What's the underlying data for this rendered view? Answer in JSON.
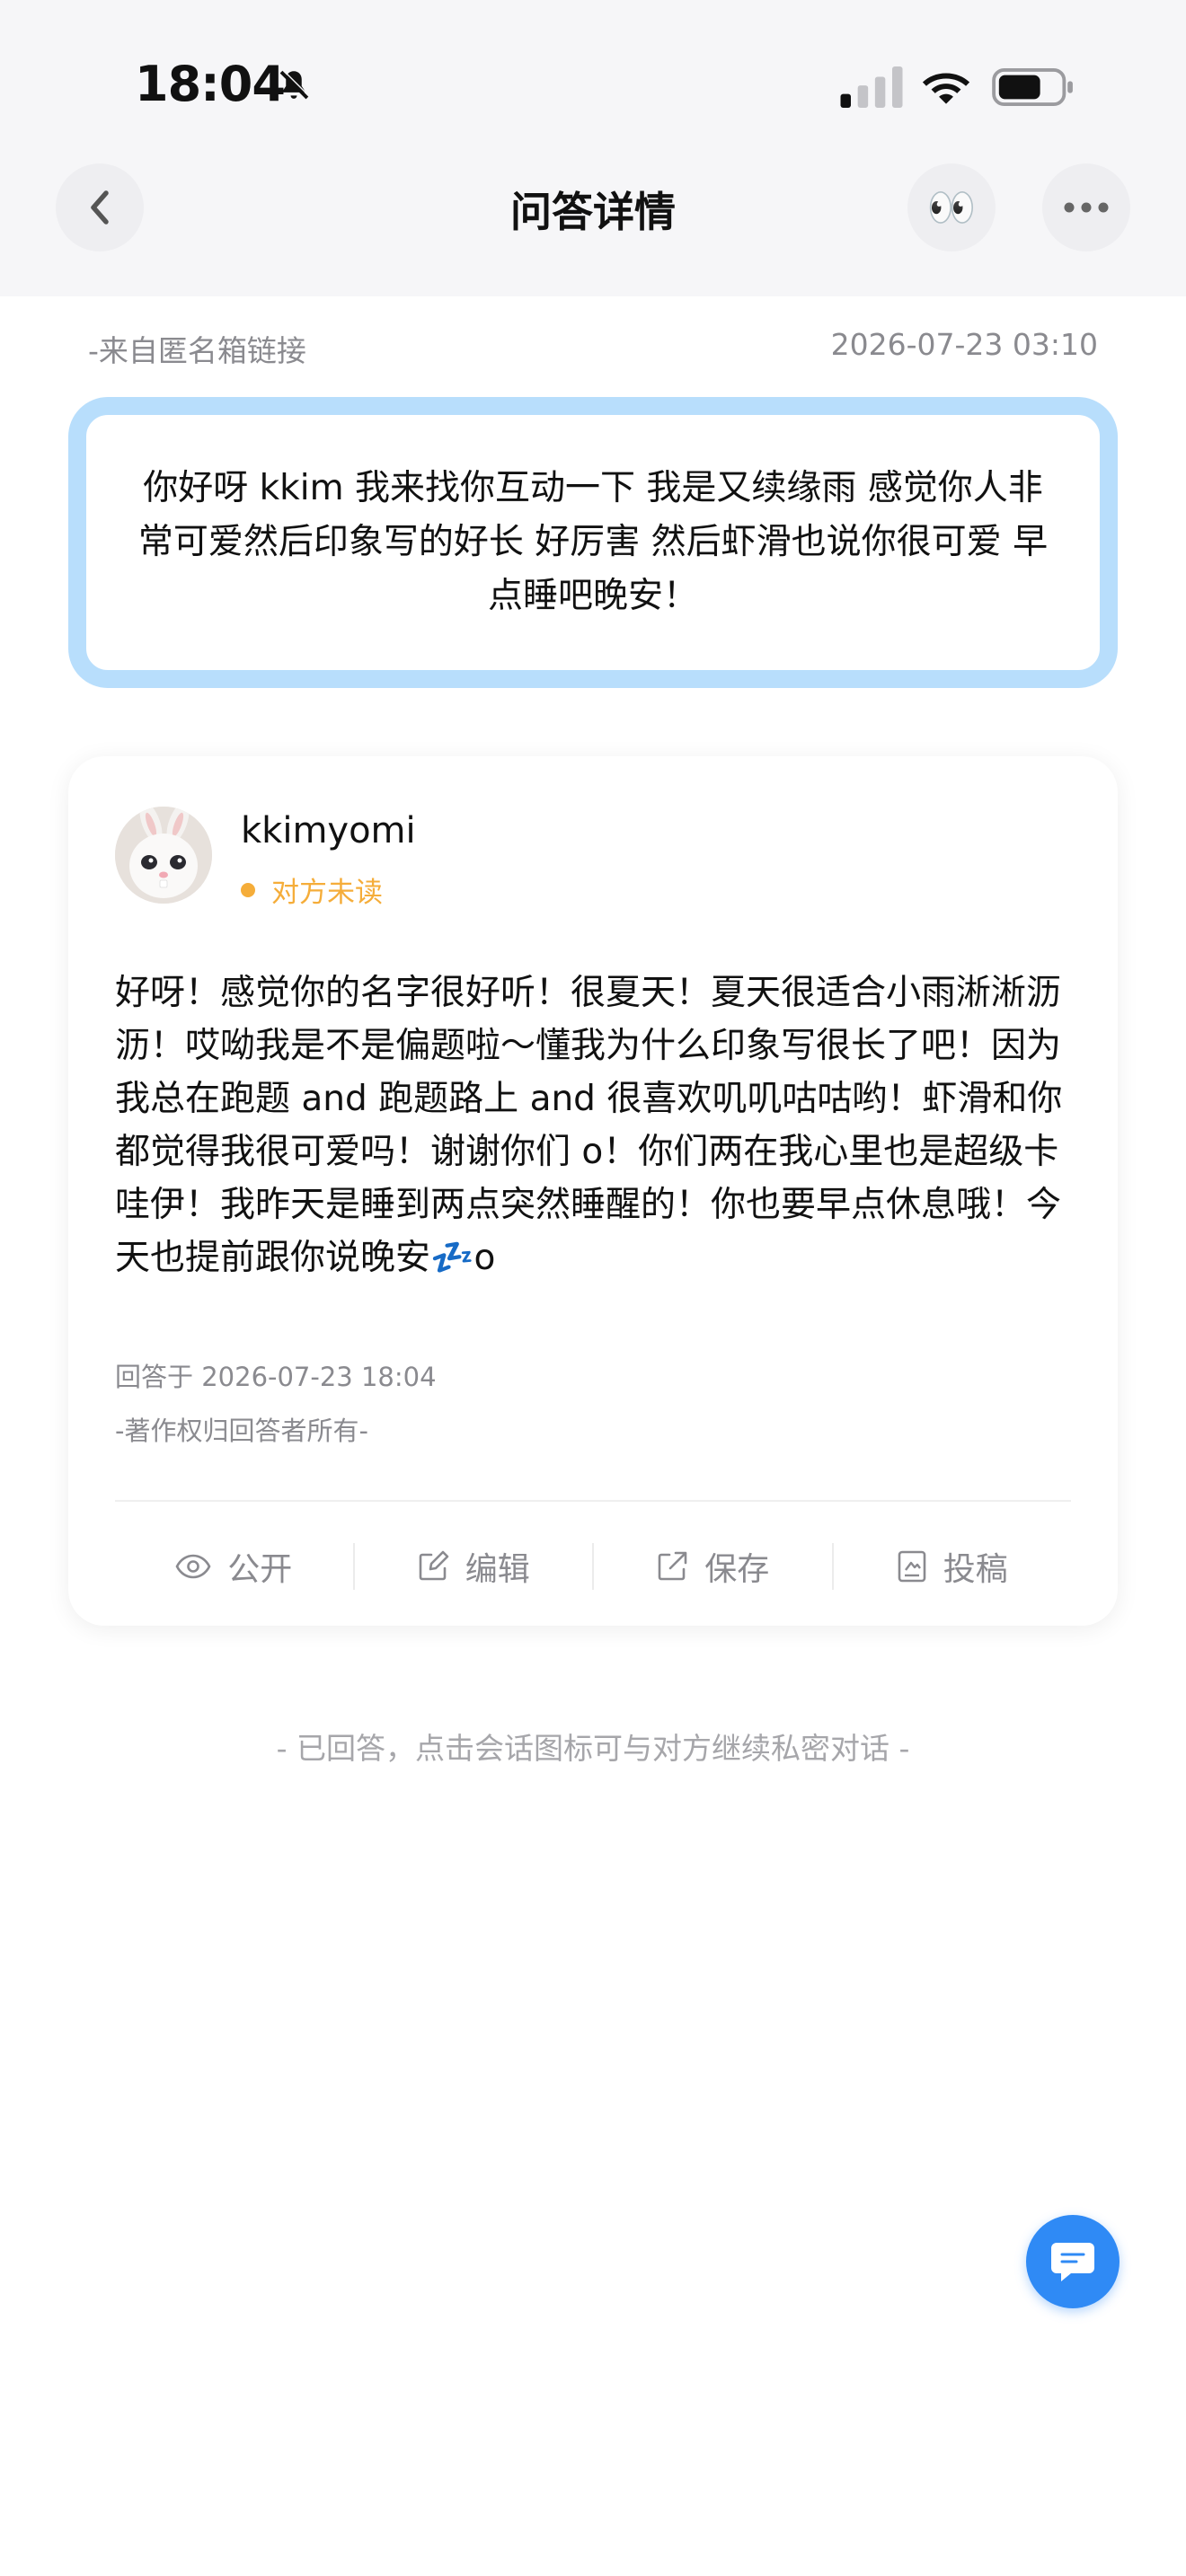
{
  "status_bar": {
    "time": "18:04"
  },
  "nav": {
    "title": "问答详情",
    "eyes_emoji": "👀"
  },
  "source": {
    "label": "-来自匿名箱链接",
    "date": "2026-07-23 03:10"
  },
  "question": {
    "text": "你好呀 kkim 我来找你互动一下 我是又续缘雨 感觉你人非常可爱然后印象写的好长 好厉害 然后虾滑也说你很可爱 早点睡吧晚安！"
  },
  "answer": {
    "username": "kkimyomi",
    "read_status": "对方未读",
    "text": "好呀！感觉你的名字很好听！很夏天！夏天很适合小雨淅淅沥沥！哎呦我是不是偏题啦～懂我为什么印象写很长了吧！因为我总在跑题 and 跑题路上 and 很喜欢叽叽咕咕哟！虾滑和你都觉得我很可爱吗！谢谢你们 o！你们两在我心里也是超级卡哇伊！我昨天是睡到两点突然睡醒的！你也要早点休息哦！今天也提前跟你说晚安💤o",
    "answered_at": "回答于 2026-07-23 18:04",
    "copyright": "-著作权归回答者所有-"
  },
  "actions": [
    {
      "label": "公开",
      "icon": "eye-icon"
    },
    {
      "label": "编辑",
      "icon": "edit-icon"
    },
    {
      "label": "保存",
      "icon": "share-export-icon"
    },
    {
      "label": "投稿",
      "icon": "document-icon"
    }
  ],
  "footer_hint": "- 已回答，点击会话图标可与对方继续私密对话 -",
  "colors": {
    "accent_blue": "#2f8af5",
    "question_border": "#b8defc",
    "unread_orange": "#f5ad3a"
  }
}
